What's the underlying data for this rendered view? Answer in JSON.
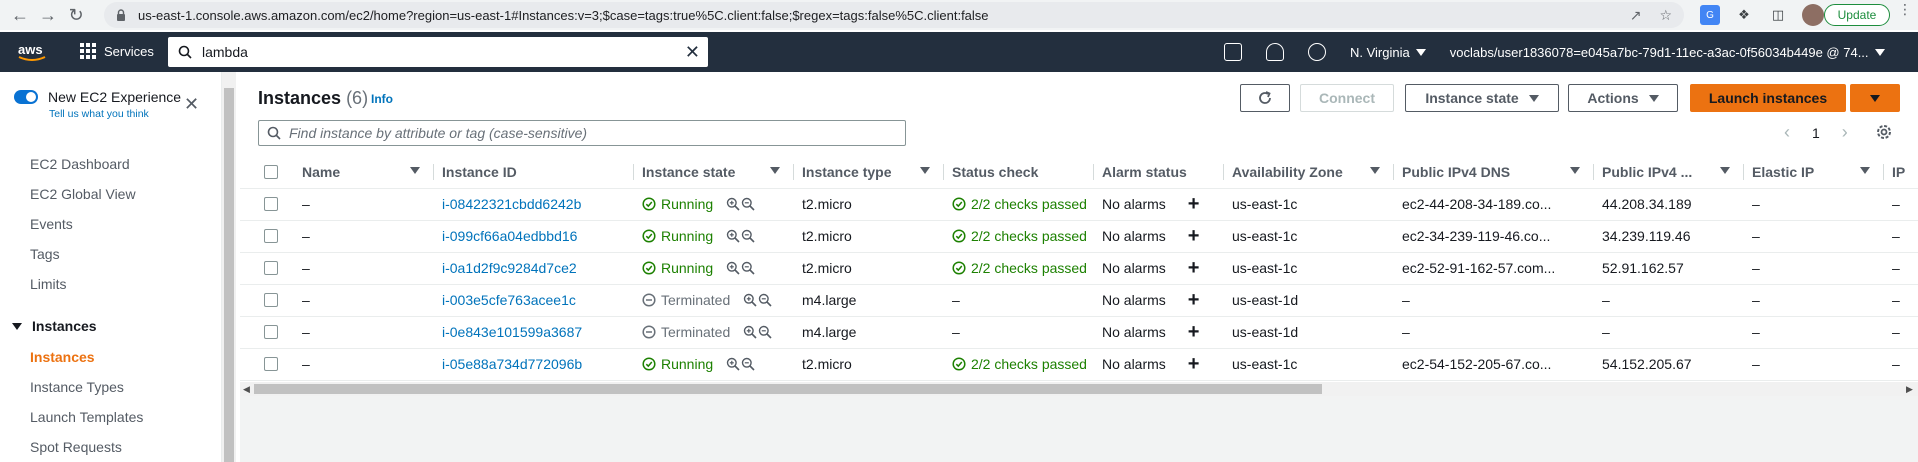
{
  "browser": {
    "url": "us-east-1.console.aws.amazon.com/ec2/home?region=us-east-1#Instances:v=3;$case=tags:true%5C.client:false;$regex=tags:false%5C.client:false",
    "update_label": "Update"
  },
  "aws_nav": {
    "services_label": "Services",
    "search_value": "lambda",
    "region": "N. Virginia",
    "account": "voclabs/user1836078=e045a7bc-79d1-11ec-a3ac-0f56034b449e @ 74..."
  },
  "sidebar": {
    "new_experience_label": "New EC2 Experience",
    "tell_us_label": "Tell us what you think",
    "top_items": [
      "EC2 Dashboard",
      "EC2 Global View",
      "Events",
      "Tags",
      "Limits"
    ],
    "group_label": "Instances",
    "group_items": [
      "Instances",
      "Instance Types",
      "Launch Templates",
      "Spot Requests"
    ],
    "active_item": "Instances"
  },
  "main": {
    "title": "Instances",
    "count": "(6)",
    "info_label": "Info",
    "connect_label": "Connect",
    "instance_state_label": "Instance state",
    "actions_label": "Actions",
    "launch_label": "Launch instances",
    "filter_placeholder": "Find instance by attribute or tag (case-sensitive)",
    "page_number": "1"
  },
  "table": {
    "columns": [
      "Name",
      "Instance ID",
      "Instance state",
      "Instance type",
      "Status check",
      "Alarm status",
      "Availability Zone",
      "Public IPv4 DNS",
      "Public IPv4 ...",
      "Elastic IP",
      "IP"
    ],
    "rows": [
      {
        "name": "–",
        "id": "i-08422321cbdd6242b",
        "state": "Running",
        "type": "t2.micro",
        "check": "2/2 checks passed",
        "alarm": "No alarms",
        "az": "us-east-1c",
        "dns": "ec2-44-208-34-189.co...",
        "ip": "44.208.34.189",
        "eip": "–",
        "extra": "–"
      },
      {
        "name": "–",
        "id": "i-099cf66a04edbbd16",
        "state": "Running",
        "type": "t2.micro",
        "check": "2/2 checks passed",
        "alarm": "No alarms",
        "az": "us-east-1c",
        "dns": "ec2-34-239-119-46.co...",
        "ip": "34.239.119.46",
        "eip": "–",
        "extra": "–"
      },
      {
        "name": "–",
        "id": "i-0a1d2f9c9284d7ce2",
        "state": "Running",
        "type": "t2.micro",
        "check": "2/2 checks passed",
        "alarm": "No alarms",
        "az": "us-east-1c",
        "dns": "ec2-52-91-162-57.com...",
        "ip": "52.91.162.57",
        "eip": "–",
        "extra": "–"
      },
      {
        "name": "–",
        "id": "i-003e5cfe763acee1c",
        "state": "Terminated",
        "type": "m4.large",
        "check": "–",
        "alarm": "No alarms",
        "az": "us-east-1d",
        "dns": "–",
        "ip": "–",
        "eip": "–",
        "extra": "–"
      },
      {
        "name": "–",
        "id": "i-0e843e101599a3687",
        "state": "Terminated",
        "type": "m4.large",
        "check": "–",
        "alarm": "No alarms",
        "az": "us-east-1d",
        "dns": "–",
        "ip": "–",
        "eip": "–",
        "extra": "–"
      },
      {
        "name": "–",
        "id": "i-05e88a734d772096b",
        "state": "Running",
        "type": "t2.micro",
        "check": "2/2 checks passed",
        "alarm": "No alarms",
        "az": "us-east-1c",
        "dns": "ec2-54-152-205-67.co...",
        "ip": "54.152.205.67",
        "eip": "–",
        "extra": "–"
      }
    ]
  },
  "colors": {
    "aws_nav": "#232f3e",
    "accent_orange": "#ec7211",
    "link_blue": "#0073bb",
    "success_green": "#1d8102"
  }
}
